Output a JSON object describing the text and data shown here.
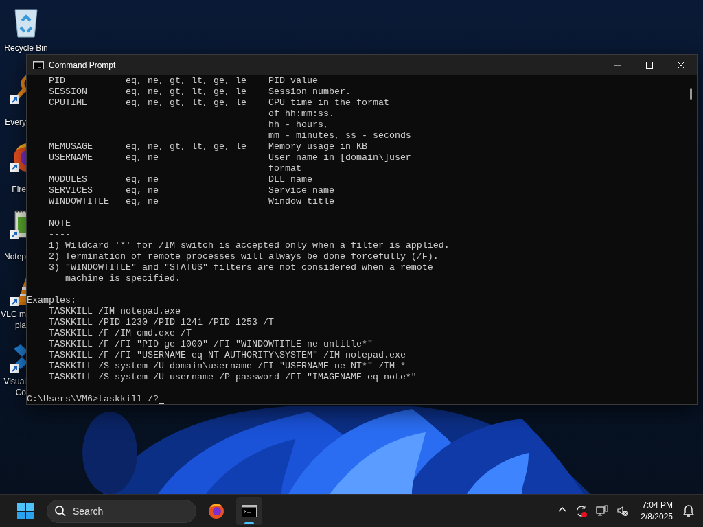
{
  "desktop_icons": [
    {
      "kind": "recycle-bin",
      "label": [
        "Recycle Bin"
      ]
    },
    {
      "kind": "search",
      "label": [
        "Every"
      ]
    },
    {
      "kind": "browser",
      "label": [
        "Fire"
      ]
    },
    {
      "kind": "notepad",
      "label": [
        "Notep"
      ]
    },
    {
      "kind": "cone",
      "label": [
        "VLC m",
        "pla"
      ]
    },
    {
      "kind": "ribbon",
      "label": [
        "Visual",
        "Co"
      ]
    }
  ],
  "window": {
    "title": "Command Prompt",
    "console_blocks": [
      [
        "    PID           eq, ne, gt, lt, ge, le    PID value",
        "    SESSION       eq, ne, gt, lt, ge, le    Session number.",
        "    CPUTIME       eq, ne, gt, lt, ge, le    CPU time in the format",
        "                                            of hh:mm:ss.",
        "                                            hh - hours,",
        "                                            mm - minutes, ss - seconds",
        "    MEMUSAGE      eq, ne, gt, lt, ge, le    Memory usage in KB",
        "    USERNAME      eq, ne                    User name in [domain\\]user",
        "                                            format",
        "    MODULES       eq, ne                    DLL name",
        "    SERVICES      eq, ne                    Service name",
        "    WINDOWTITLE   eq, ne                    Window title"
      ],
      [
        "    NOTE",
        "    ----",
        "    1) Wildcard '*' for /IM switch is accepted only when a filter is applied.",
        "    2) Termination of remote processes will always be done forcefully (/F).",
        "    3) \"WINDOWTITLE\" and \"STATUS\" filters are not considered when a remote",
        "       machine is specified."
      ],
      [
        "Examples:",
        "    TASKKILL /IM notepad.exe",
        "    TASKKILL /PID 1230 /PID 1241 /PID 1253 /T",
        "    TASKKILL /F /IM cmd.exe /T",
        "    TASKKILL /F /FI \"PID ge 1000\" /FI \"WINDOWTITLE ne untitle*\"",
        "    TASKKILL /F /FI \"USERNAME eq NT AUTHORITY\\SYSTEM\" /IM notepad.exe",
        "    TASKKILL /S system /U domain\\username /FI \"USERNAME ne NT*\" /IM *",
        "    TASKKILL /S system /U username /P password /FI \"IMAGENAME eq note*\""
      ],
      [
        "C:\\Users\\VM6>taskkill /?"
      ]
    ]
  },
  "taskbar": {
    "search": {
      "placeholder": "Search"
    },
    "apps": [
      {
        "kind": "browser",
        "selected": false
      },
      {
        "kind": "terminal",
        "selected": true
      }
    ],
    "clock": {
      "time": "7:04 PM",
      "date": "2/8/2025"
    }
  }
}
